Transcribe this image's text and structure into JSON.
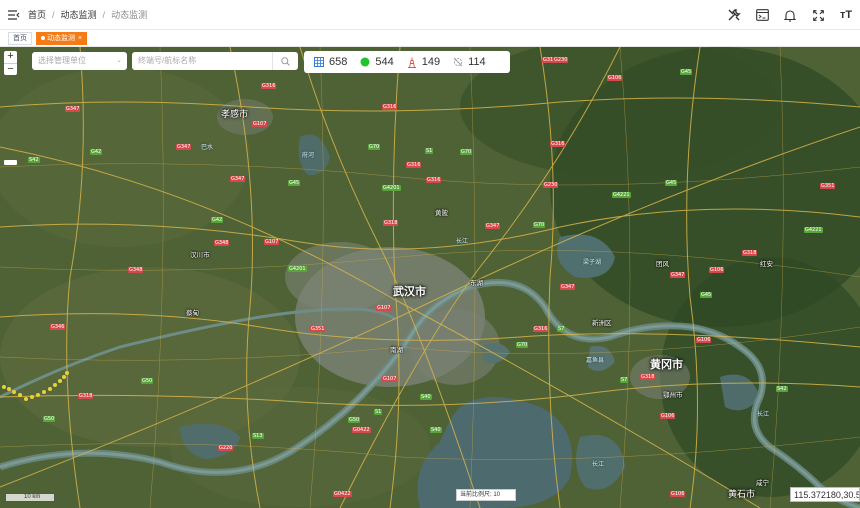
{
  "header": {
    "breadcrumb": [
      "首页",
      "动态监测",
      "动态监测"
    ],
    "separator": "/",
    "tool_icons": [
      "tools-icon",
      "screen-icon",
      "bell-icon",
      "fullscreen-icon",
      "font-size-icon"
    ],
    "font_size_glyph": "тT"
  },
  "tabs": [
    {
      "label": "首页",
      "active": false
    },
    {
      "label": "动态监测",
      "active": true,
      "close": "×"
    }
  ],
  "map": {
    "zoom_in": "+",
    "zoom_out": "−",
    "unit_select": {
      "placeholder": "选择管理单位",
      "arrow": "⌄"
    },
    "search": {
      "placeholder": "终端号/航标名称"
    },
    "stats": [
      {
        "icon": "grid-icon",
        "value": "658"
      },
      {
        "icon": "online-dot-icon",
        "value": "544"
      },
      {
        "icon": "buoy-icon",
        "value": "149"
      },
      {
        "icon": "offline-icon",
        "value": "114"
      }
    ],
    "scale_label": "10 km",
    "zoom_level_label": "当前比例尺: 10",
    "coordinates": "115.372180,30.5",
    "cities": [
      "武汉市",
      "黄冈市",
      "孝感市",
      "黄石市"
    ],
    "places": [
      "汉川市",
      "东湖",
      "新洲区",
      "鄂州市",
      "南湖",
      "黄陂",
      "嘉鱼县",
      "团风",
      "红安",
      "浠水",
      "蔡甸",
      "梁子湖",
      "咸宁"
    ],
    "rivers": [
      "长江",
      "汉江",
      "长江",
      "府河",
      "巴水"
    ],
    "roads": [
      "G347",
      "G316",
      "G318",
      "G230",
      "G106",
      "G45",
      "G70",
      "G50",
      "G42",
      "G4201",
      "G107",
      "S1",
      "S7",
      "G348",
      "G346",
      "G351",
      "S42",
      "G0422",
      "G220",
      "G4221",
      "S13",
      "S40"
    ],
    "colors": {
      "road_national": "#d6494a",
      "road_provincial": "#5aa53a",
      "active_tab": "#f57c14",
      "online": "#22c32e",
      "track": "#e8d23a"
    }
  }
}
